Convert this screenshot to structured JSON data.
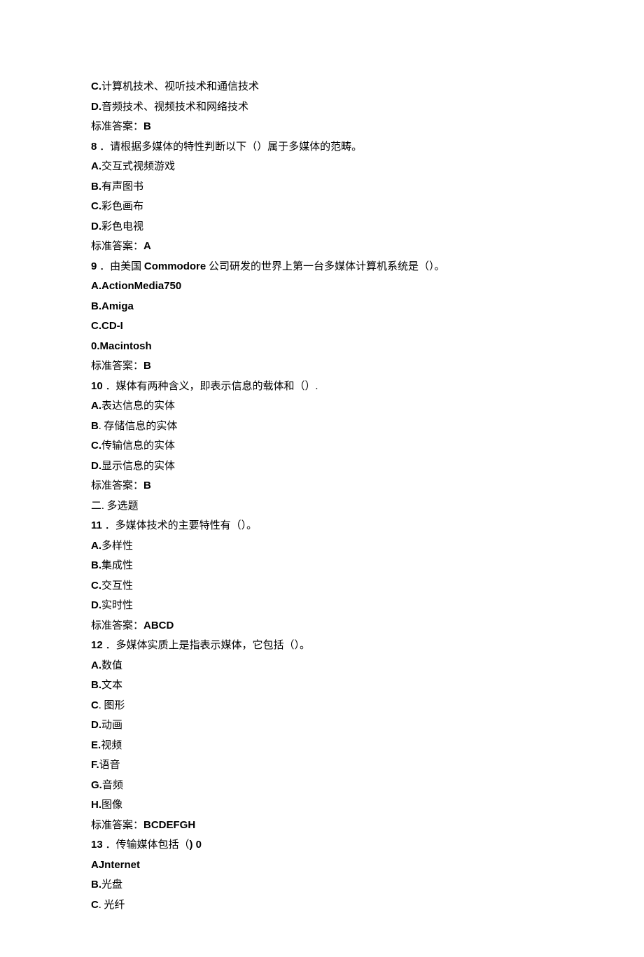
{
  "pre_options": {
    "c": {
      "letter": "C.",
      "text": "计算机技术、视听技术和通信技术"
    },
    "d": {
      "letter": "D.",
      "text": "音频技术、视频技术和网络技术"
    },
    "ans_label": "标准答案：",
    "ans_val": "B"
  },
  "q8": {
    "num": "8",
    "stem": " ．请根据多媒体的特性判断以下（）属于多媒体的范畴。",
    "a": {
      "letter": "A.",
      "text": "交互式视频游戏"
    },
    "b": {
      "letter": "B.",
      "text": "有声图书"
    },
    "c": {
      "letter": "C.",
      "text": "彩色画布"
    },
    "d": {
      "letter": "D.",
      "text": "彩色电视"
    },
    "ans_label": "标准答案：",
    "ans_val": "A"
  },
  "q9": {
    "num": "9",
    "stem_pre": " ．由美国 ",
    "stem_bold": "Commodore",
    "stem_post": " 公司研发的世界上第一台多媒体计算机系统是（）。",
    "a": "A.ActionMedia750",
    "b": "B.Amiga",
    "c": "C.CD-I",
    "d": "0.Macintosh",
    "ans_label": "标准答案：",
    "ans_val": "B"
  },
  "q10": {
    "num": "10",
    "stem": " ．媒体有两种含义，即表示信息的载体和（）.",
    "a": {
      "letter": "A.",
      "text": "表达信息的实体"
    },
    "b": {
      "letter": "B",
      "text": ". 存储信息的实体"
    },
    "c": {
      "letter": "C.",
      "text": "传输信息的实体"
    },
    "d": {
      "letter": "D.",
      "text": "显示信息的实体"
    },
    "ans_label": "标准答案：",
    "ans_val": "B"
  },
  "section2": "二. 多选题",
  "q11": {
    "num": "11",
    "stem": " ．多媒体技术的主要特性有（）。",
    "a": {
      "letter": "A.",
      "text": "多样性"
    },
    "b": {
      "letter": "B.",
      "text": "集成性"
    },
    "c": {
      "letter": "C.",
      "text": "交互性"
    },
    "d": {
      "letter": "D.",
      "text": "实时性"
    },
    "ans_label": "标准答案：",
    "ans_val": "ABCD"
  },
  "q12": {
    "num": "12",
    "stem": " ．多媒体实质上是指表示媒体，它包括（）。",
    "a": {
      "letter": "A.",
      "text": "数值"
    },
    "b": {
      "letter": "B.",
      "text": "文本"
    },
    "c": {
      "letter": "C",
      "text": ". 图形"
    },
    "d": {
      "letter": "D.",
      "text": "动画"
    },
    "e": {
      "letter": "E.",
      "text": "视频"
    },
    "f": {
      "letter": "F.",
      "text": "语音"
    },
    "g": {
      "letter": "G.",
      "text": "音频"
    },
    "h": {
      "letter": "H.",
      "text": "图像"
    },
    "ans_label": "标准答案：",
    "ans_val": "BCDEFGH"
  },
  "q13": {
    "num": "13",
    "stem_pre": " ．传输媒体包括（",
    "stem_bold": ") 0",
    "a": "AJnternet",
    "b": {
      "letter": "B.",
      "text": "光盘"
    },
    "c": {
      "letter": "C",
      "text": ". 光纤"
    }
  }
}
